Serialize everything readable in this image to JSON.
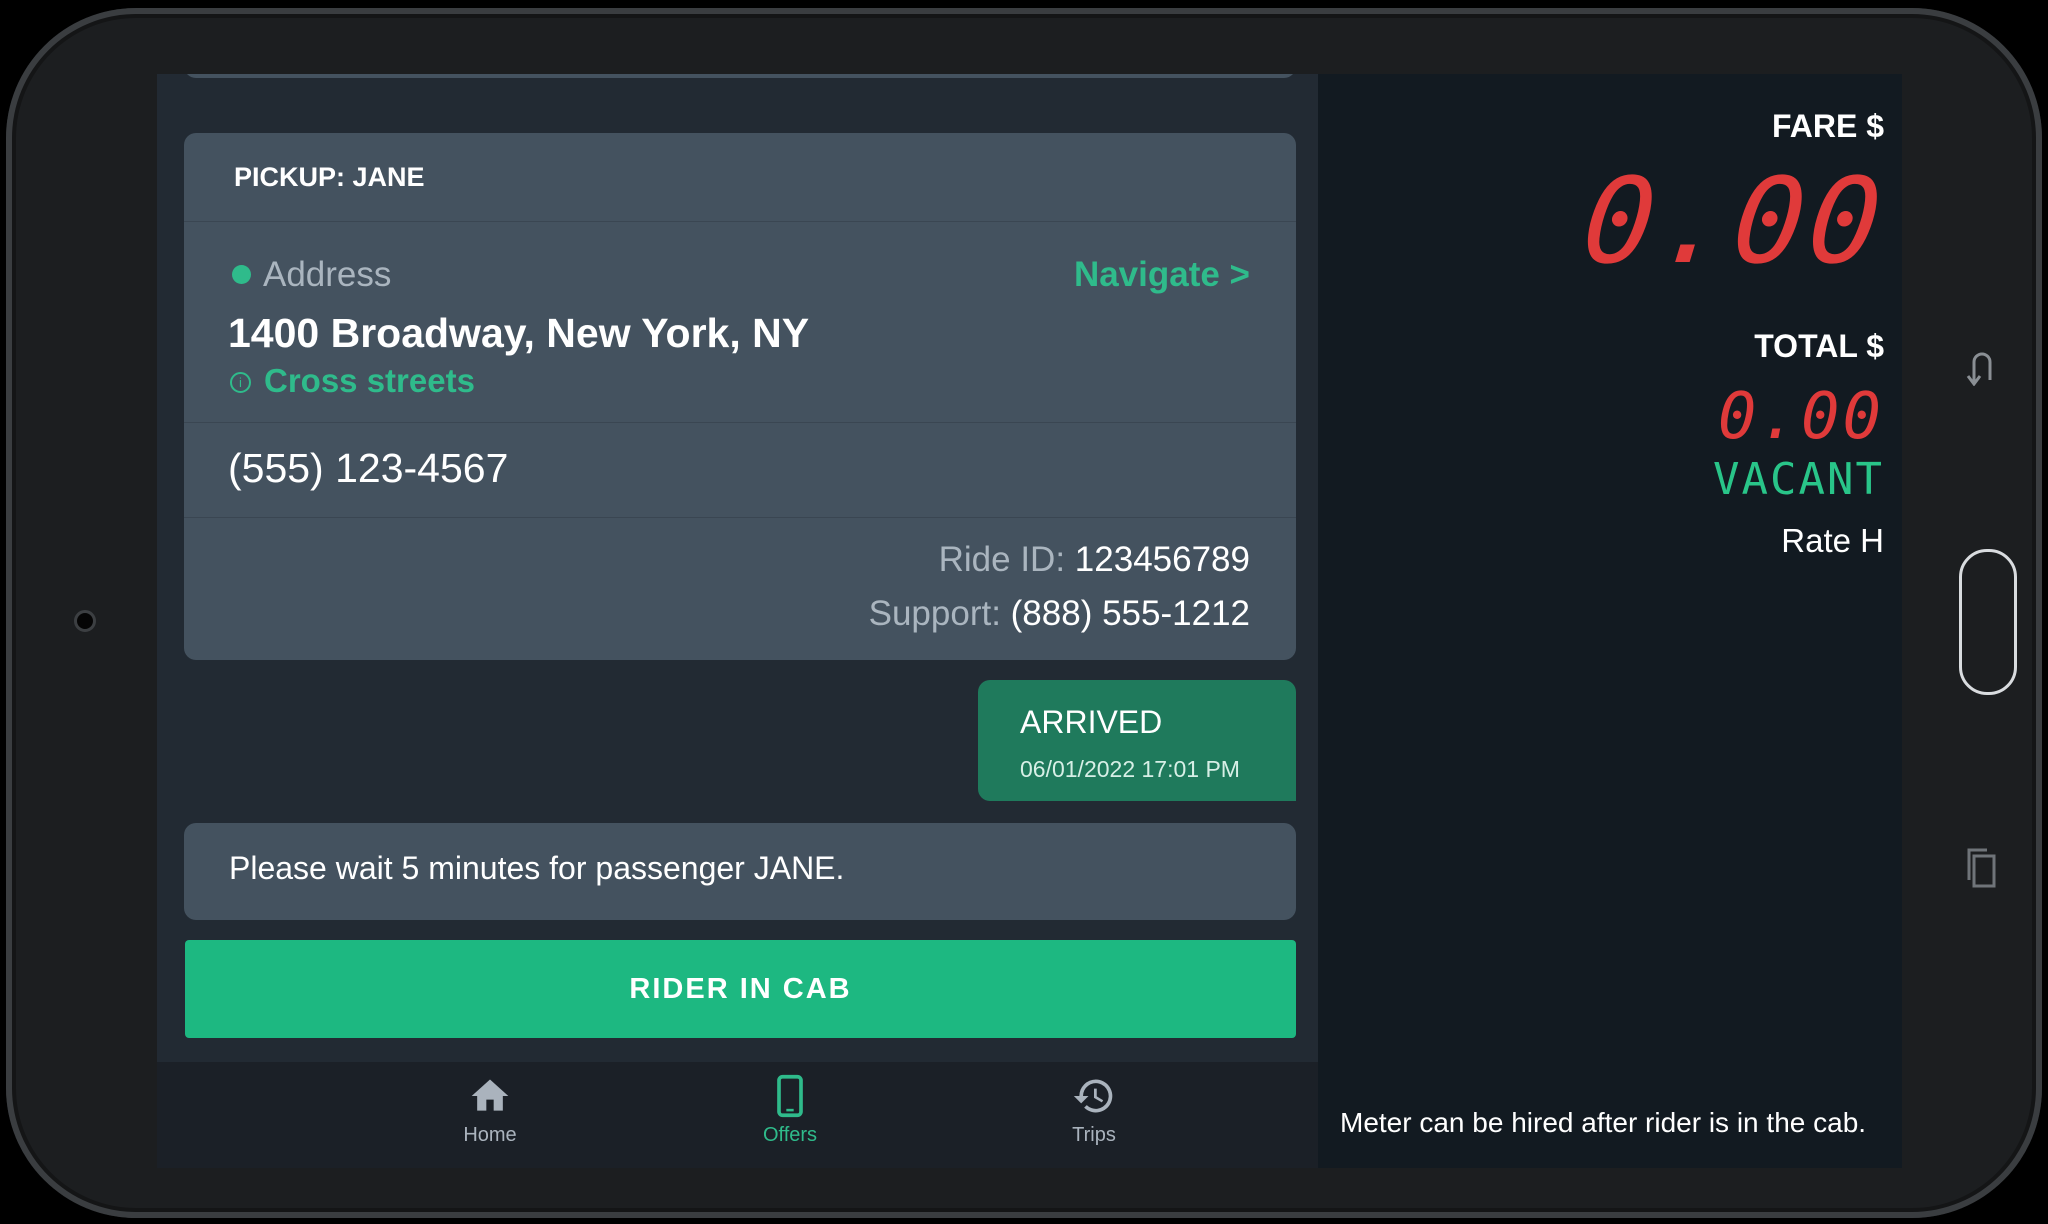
{
  "pickup": {
    "header": "PICKUP: JANE",
    "address_label": "Address",
    "navigate": "Navigate >",
    "address": "1400 Broadway, New York, NY",
    "cross_streets": "Cross streets",
    "phone": "(555) 123-4567",
    "ride_id_label": "Ride ID:",
    "ride_id": "123456789",
    "support_label": "Support:",
    "support_phone": "(888) 555-1212"
  },
  "status": {
    "title": "ARRIVED",
    "timestamp": "06/01/2022 17:01 PM"
  },
  "message": "Please wait 5 minutes for passenger JANE.",
  "action_button": "RIDER IN CAB",
  "nav": [
    {
      "label": "Home",
      "icon": "home-icon",
      "active": false
    },
    {
      "label": "Offers",
      "icon": "phone-icon",
      "active": true
    },
    {
      "label": "Trips",
      "icon": "history-icon",
      "active": false
    }
  ],
  "meter": {
    "fare_label": "FARE $",
    "fare_value": "0.00",
    "total_label": "TOTAL $",
    "total_value": "0.00",
    "status": "VACANT",
    "rate": "Rate H",
    "note": "Meter can be hired after rider is in the cab."
  },
  "colors": {
    "accent": "#2fbb8b",
    "button": "#1db881",
    "meter_red": "#e03a3a",
    "vacant_green": "#29c589"
  }
}
